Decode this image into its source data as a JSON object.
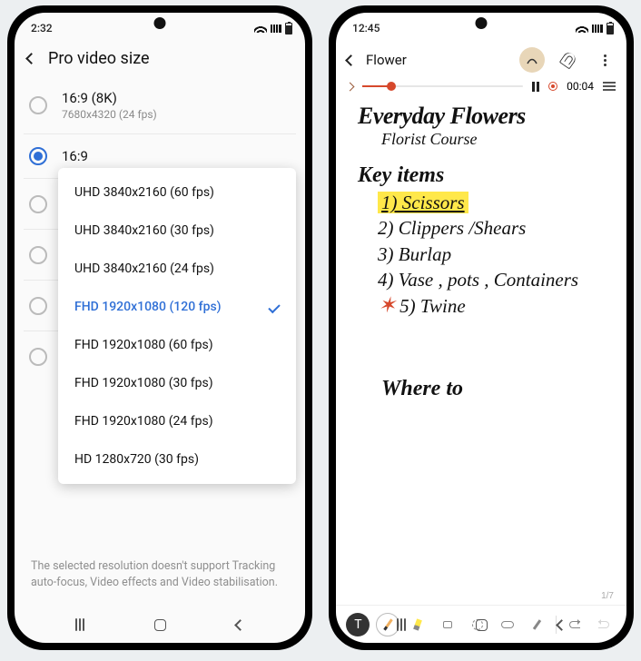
{
  "left": {
    "status_time": "2:32",
    "header": "Pro video size",
    "rows": [
      {
        "title": "16:9 (8K)",
        "sub": "7680x4320 (24 fps)",
        "selected": false
      },
      {
        "title": "16:9",
        "sub": "",
        "selected": true
      },
      {
        "title": "",
        "sub": "",
        "selected": false
      },
      {
        "title": "",
        "sub": "",
        "selected": false
      },
      {
        "title": "",
        "sub": "",
        "selected": false
      },
      {
        "title": "",
        "sub": "",
        "selected": false
      }
    ],
    "dropdown": [
      {
        "label": "UHD 3840x2160 (60 fps)",
        "selected": false
      },
      {
        "label": "UHD 3840x2160 (30 fps)",
        "selected": false
      },
      {
        "label": "UHD 3840x2160 (24 fps)",
        "selected": false
      },
      {
        "label": "FHD 1920x1080 (120 fps)",
        "selected": true
      },
      {
        "label": "FHD 1920x1080 (60 fps)",
        "selected": false
      },
      {
        "label": "FHD 1920x1080 (30 fps)",
        "selected": false
      },
      {
        "label": "FHD 1920x1080 (24 fps)",
        "selected": false
      },
      {
        "label": "HD 1280x720 (30 fps)",
        "selected": false
      }
    ],
    "footnote": "The selected resolution doesn't support Tracking auto-focus, Video effects and Video stabilisation."
  },
  "right": {
    "status_time": "12:45",
    "title": "Flower",
    "player_time": "00:04",
    "page_indicator": "1/7",
    "note": {
      "h1": "Everyday Flowers",
      "h1b": "Florist Course",
      "h2": "Key items",
      "items": [
        "1) Scissors",
        "2) Clippers /Shears",
        "3) Burlap",
        "4) Vase , pots , Containers",
        "5) Twine"
      ],
      "h3": "Where to"
    }
  }
}
